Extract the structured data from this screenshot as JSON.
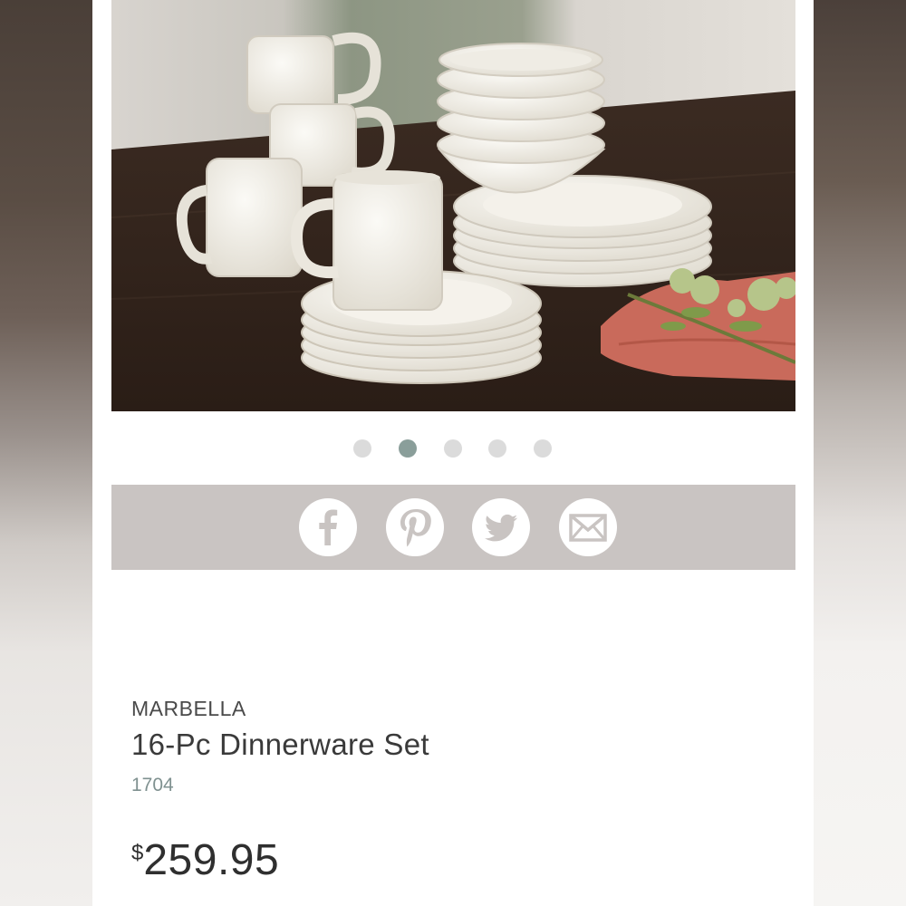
{
  "carousel": {
    "total_slides": 5,
    "active_index": 1,
    "colors": {
      "active": "#8a9e9a",
      "inactive": "#dbdbdb"
    }
  },
  "share": {
    "icons": [
      "facebook-icon",
      "pinterest-icon",
      "twitter-icon",
      "email-icon"
    ],
    "bar_color": "#c9c4c2"
  },
  "product": {
    "brand": "MARBELLA",
    "name": "16-Pc Dinnerware Set",
    "sku": "1704",
    "currency_symbol": "$",
    "price": "259.95"
  }
}
